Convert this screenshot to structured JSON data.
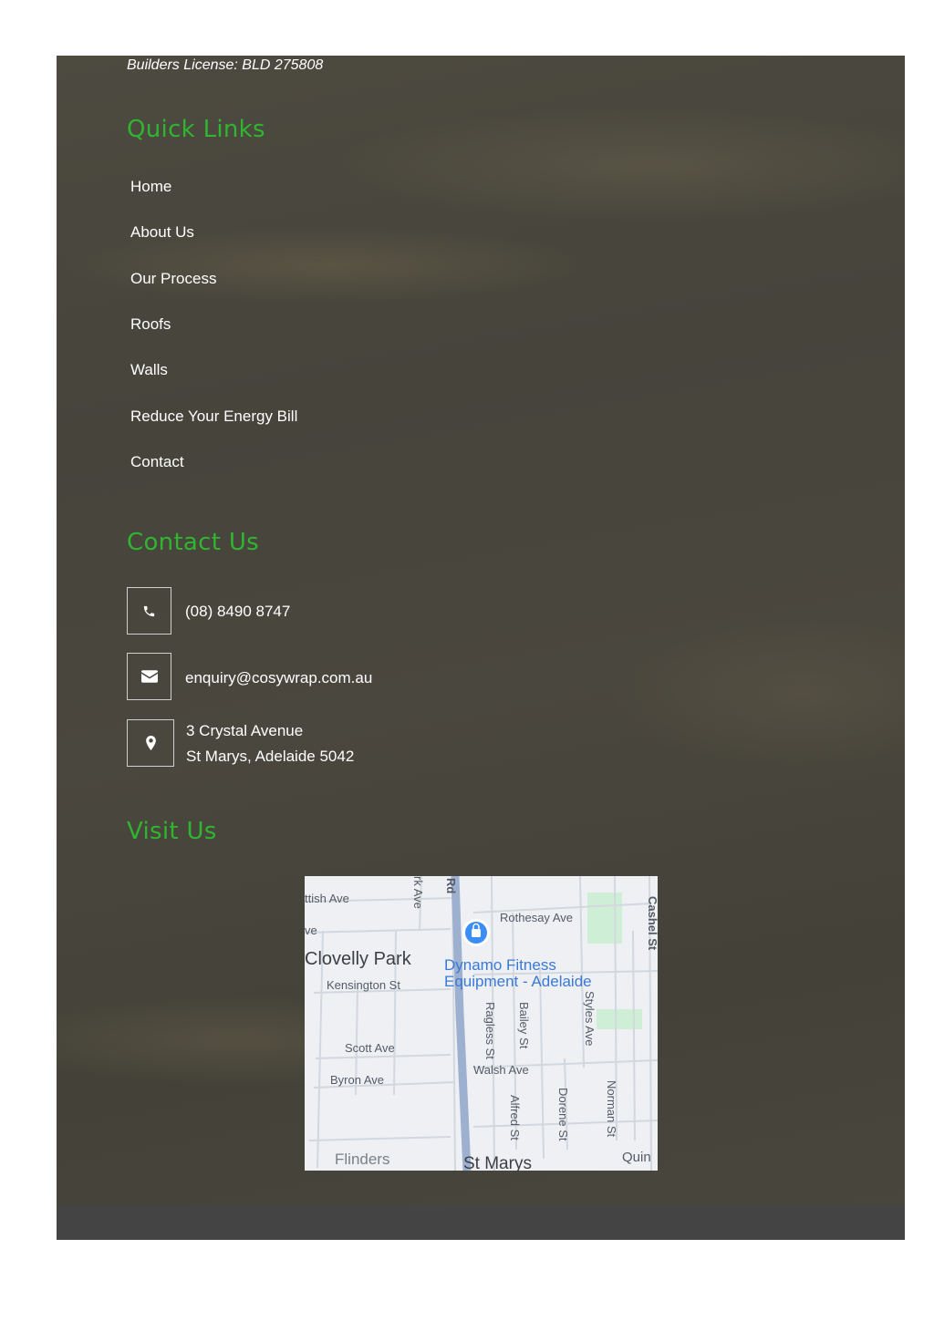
{
  "footer": {
    "license": "Builders License: BLD 275808",
    "quick_links": {
      "heading": "Quick Links",
      "items": [
        "Home",
        "About Us",
        "Our Process",
        "Roofs",
        "Walls",
        "Reduce Your Energy Bill",
        "Contact"
      ]
    },
    "contact": {
      "heading": "Contact Us",
      "phone": "(08) 8490 8747",
      "email": "enquiry@cosywrap.com.au",
      "address_line1": "3 Crystal Avenue",
      "address_line2": "St Marys, Adelaide 5042",
      "icons": [
        "phone-icon",
        "envelope-icon",
        "map-marker-icon"
      ]
    },
    "visit": {
      "heading": "Visit Us",
      "map_labels": {
        "ttish_ave": "ttish Ave",
        "ve": "ve",
        "rk_ave": "rk Ave",
        "rd": "Rd",
        "rothesay_ave": "Rothesay Ave",
        "cashel_st": "Cashel St",
        "clovelly_park": "Clovelly Park",
        "place_line1": "Dynamo Fitness",
        "place_line2": "Equipment - Adelaide",
        "kensington_st": "Kensington St",
        "ragless_st": "Ragless St",
        "bailey_st": "Bailey St",
        "styles_ave": "Styles Ave",
        "scott_ave": "Scott Ave",
        "walsh_ave": "Walsh Ave",
        "byron_ave": "Byron Ave",
        "alfred_st": "Alfred St",
        "dorene_st": "Dorene St",
        "norman_st": "Norman St",
        "flinders": "Flinders",
        "st_marys": "St Marys",
        "quin": "Quin"
      }
    }
  },
  "colors": {
    "heading_green": "#2fb52f",
    "link_white": "#ffffff",
    "bottom_bar": "#444444",
    "map_place_blue": "#3a79d6"
  }
}
